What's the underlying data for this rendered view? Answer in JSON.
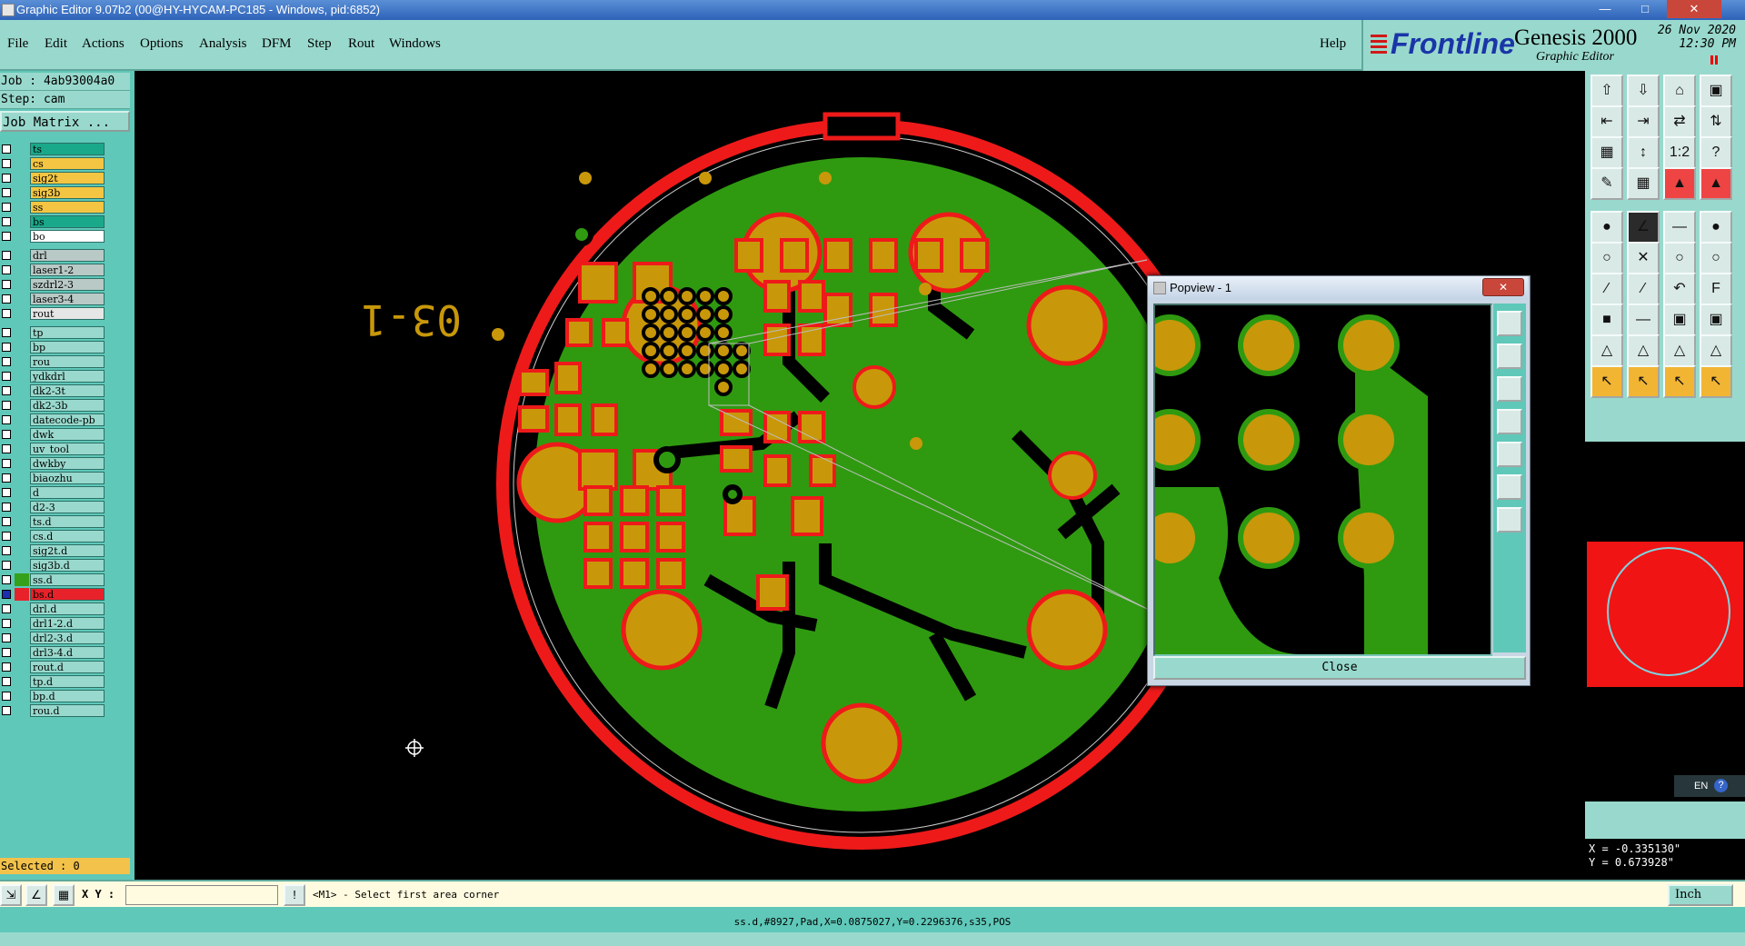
{
  "window": {
    "title": "Graphic Editor 9.07b2 (00@HY-HYCAM-PC185 - Windows, pid:6852)"
  },
  "menu": [
    "File",
    "Edit",
    "Actions",
    "Options",
    "Analysis",
    "DFM",
    "Step",
    "Rout",
    "Windows"
  ],
  "help": "Help",
  "logo": {
    "brand": "Frontline",
    "product": "Genesis 2000",
    "subtitle": "Graphic Editor",
    "date": "26 Nov 2020",
    "time": "12:30 PM"
  },
  "job": {
    "job_line": "Job : 4ab93004a0",
    "step_line": "Step: cam",
    "matrix_button": "Job Matrix ..."
  },
  "layer_groups": [
    [
      {
        "name": "ts",
        "color": "#1aa88a"
      },
      {
        "name": "cs",
        "color": "#f4c542"
      },
      {
        "name": "sig2t",
        "color": "#f4c542"
      },
      {
        "name": "sig3b",
        "color": "#f4c542"
      },
      {
        "name": "ss",
        "color": "#f4c542"
      },
      {
        "name": "bs",
        "color": "#1aa88a"
      },
      {
        "name": "bo",
        "color": "#ffffff"
      }
    ],
    [
      {
        "name": "drl",
        "color": "#b9c9c6"
      },
      {
        "name": "laser1-2",
        "color": "#b9c9c6"
      },
      {
        "name": "szdrl2-3",
        "color": "#b9c9c6"
      },
      {
        "name": "laser3-4",
        "color": "#b9c9c6"
      },
      {
        "name": "rout",
        "color": "#e6e6e6"
      }
    ],
    [
      {
        "name": "tp",
        "color": "#99d9cd"
      },
      {
        "name": "bp",
        "color": "#99d9cd"
      },
      {
        "name": "rou",
        "color": "#99d9cd"
      },
      {
        "name": "ydkdrl",
        "color": "#99d9cd"
      },
      {
        "name": "dk2-3t",
        "color": "#99d9cd"
      },
      {
        "name": "dk2-3b",
        "color": "#99d9cd"
      },
      {
        "name": "datecode-pb",
        "color": "#99d9cd"
      },
      {
        "name": "dwk",
        "color": "#99d9cd"
      },
      {
        "name": "uv_tool",
        "color": "#99d9cd"
      },
      {
        "name": "dwkby",
        "color": "#99d9cd"
      },
      {
        "name": "biaozhu",
        "color": "#99d9cd"
      },
      {
        "name": "d",
        "color": "#99d9cd"
      },
      {
        "name": "d2-3",
        "color": "#99d9cd"
      },
      {
        "name": "ts.d",
        "color": "#99d9cd"
      },
      {
        "name": "cs.d",
        "color": "#99d9cd"
      },
      {
        "name": "sig2t.d",
        "color": "#99d9cd"
      },
      {
        "name": "sig3b.d",
        "color": "#99d9cd"
      },
      {
        "name": "ss.d",
        "color": "#99d9cd",
        "swatch": "#35a11a"
      },
      {
        "name": "bs.d",
        "color": "#e8222a",
        "swatch": "#e8222a",
        "checked": true
      },
      {
        "name": "drl.d",
        "color": "#99d9cd"
      },
      {
        "name": "drl1-2.d",
        "color": "#99d9cd"
      },
      {
        "name": "drl2-3.d",
        "color": "#99d9cd"
      },
      {
        "name": "drl3-4.d",
        "color": "#99d9cd"
      },
      {
        "name": "rout.d",
        "color": "#99d9cd"
      },
      {
        "name": "tp.d",
        "color": "#99d9cd"
      },
      {
        "name": "bp.d",
        "color": "#99d9cd"
      },
      {
        "name": "rou.d",
        "color": "#99d9cd"
      }
    ]
  ],
  "selected": "Selected : 0",
  "board_text": "03-1",
  "popview": {
    "title": "Popview - 1",
    "close": "Close"
  },
  "coords": {
    "x": "X = -0.335130\"",
    "y": "Y = 0.673928\""
  },
  "lang": "EN",
  "command": {
    "xy_label": "X Y :",
    "xy_value": "",
    "prompt": "<M1> - Select first area corner",
    "units": "Inch"
  },
  "status": "ss.d,#8927,Pad,X=0.0875027,Y=0.2296376,s35,POS",
  "colors": {
    "copper": "#2f9a10",
    "pad": "#c8980a",
    "mask": "#ee1a1a",
    "background": "#000000",
    "panel": "#5fc8b9",
    "panel_light": "#99d9cd"
  }
}
